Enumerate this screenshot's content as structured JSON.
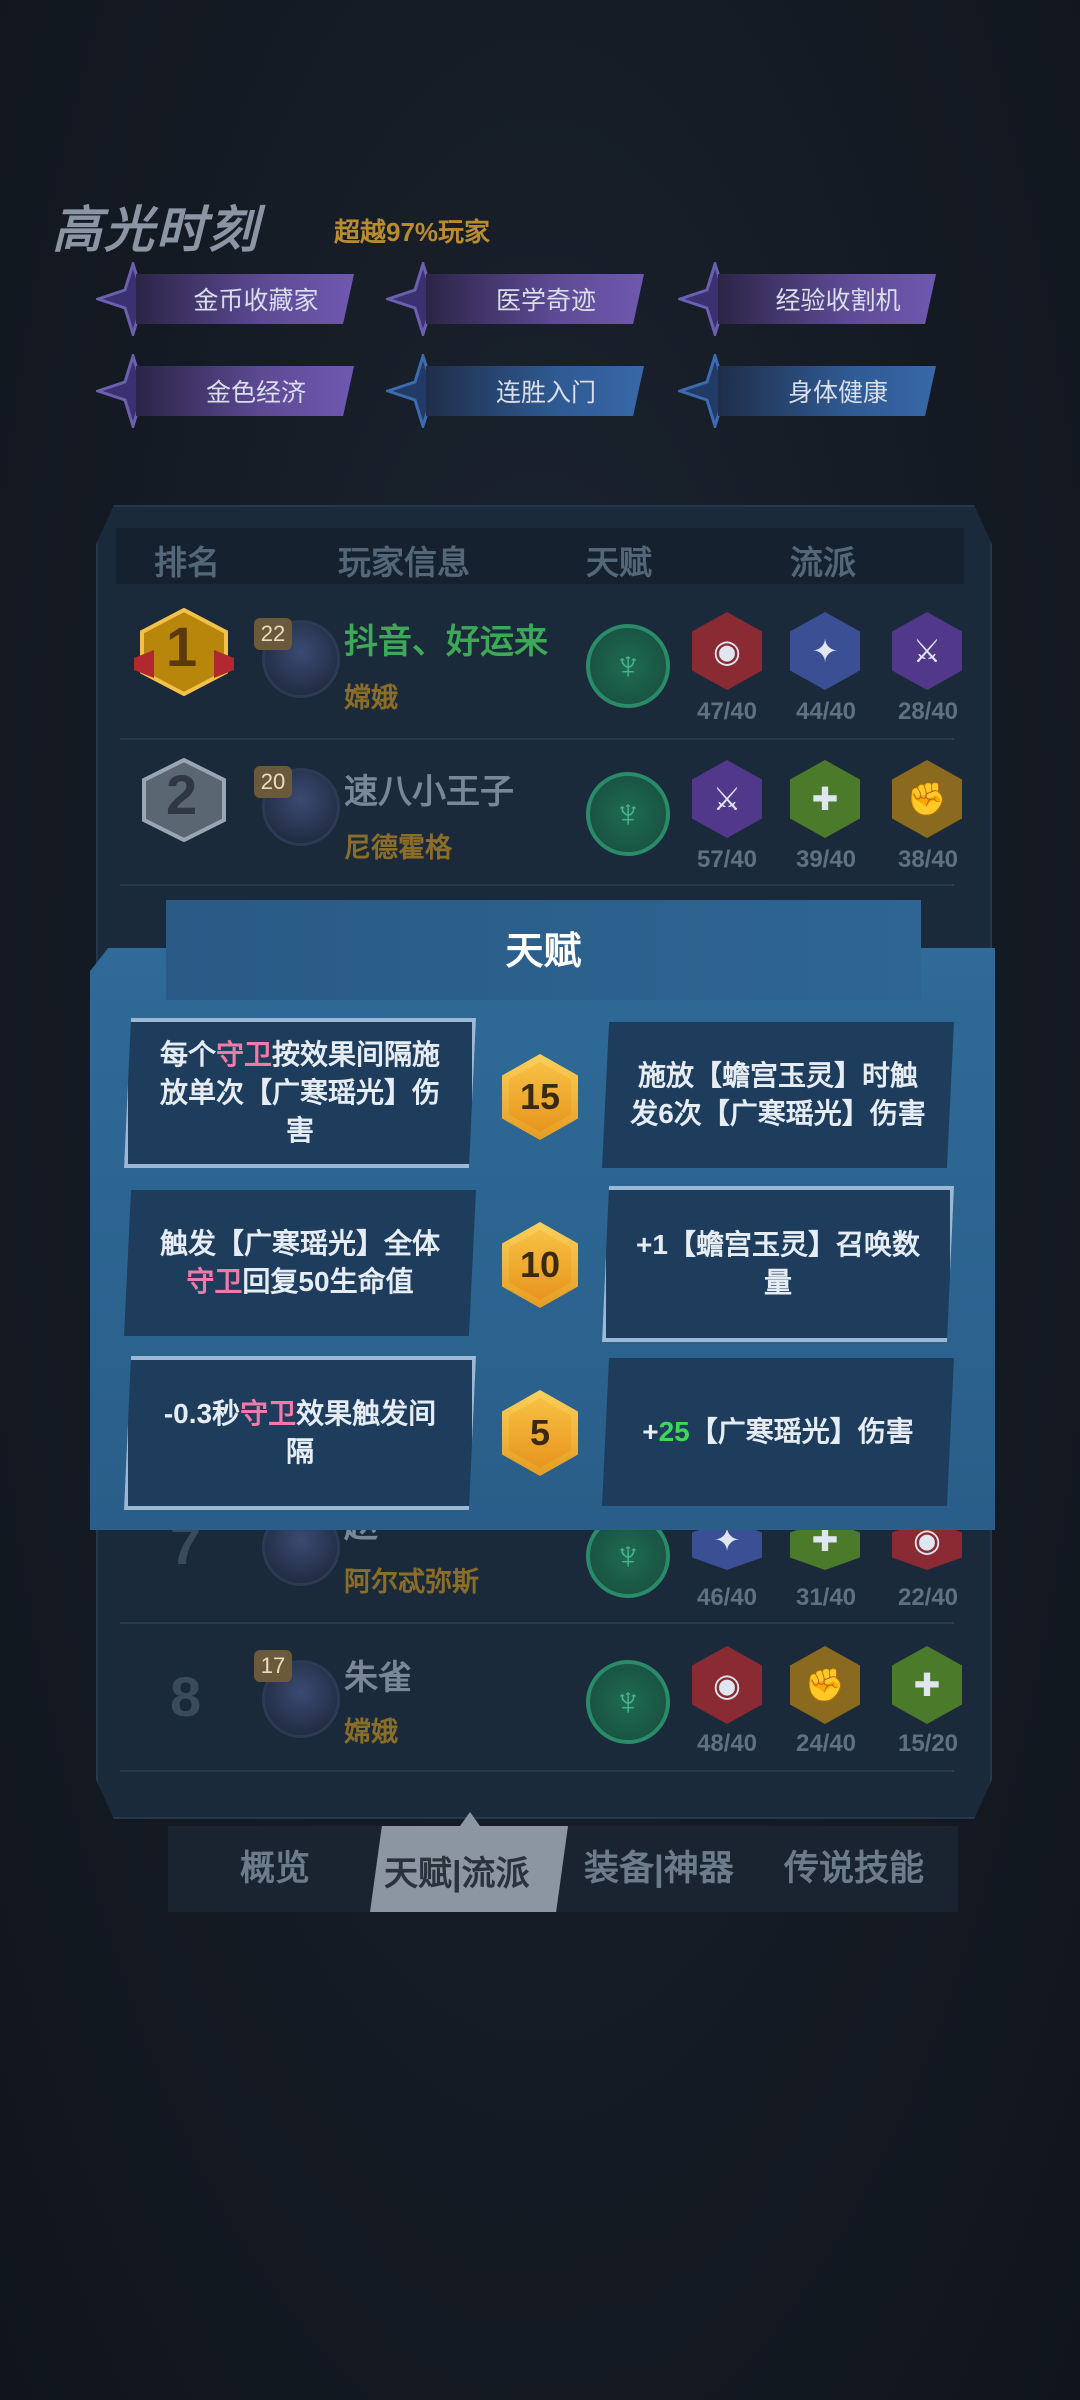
{
  "highlight": {
    "title": "高光时刻",
    "subtitle": "超越97%玩家",
    "badges": [
      {
        "label": "金币收藏家",
        "color": "purple"
      },
      {
        "label": "医学奇迹",
        "color": "purple"
      },
      {
        "label": "经验收割机",
        "color": "purple"
      },
      {
        "label": "金色经济",
        "color": "purple"
      },
      {
        "label": "连胜入门",
        "color": "blue"
      },
      {
        "label": "身体健康",
        "color": "blue"
      }
    ]
  },
  "ranking": {
    "headers": [
      "排名",
      "玩家信息",
      "天赋",
      "流派"
    ],
    "rows": [
      {
        "rank": "1",
        "level": "22",
        "name": "抖音、好运来",
        "hero": "嫦娥",
        "counts": [
          "47/40",
          "44/40",
          "28/40"
        ]
      },
      {
        "rank": "2",
        "level": "20",
        "name": "速八小王子",
        "hero": "尼德霍格",
        "counts": [
          "57/40",
          "39/40",
          "38/40"
        ]
      },
      {
        "rank": "7",
        "level": "",
        "name": "赵",
        "hero": "阿尔忒弥斯",
        "counts": [
          "46/40",
          "31/40",
          "22/40"
        ]
      },
      {
        "rank": "8",
        "level": "17",
        "name": "朱雀",
        "hero": "嫦娥",
        "counts": [
          "48/40",
          "24/40",
          "15/20"
        ]
      }
    ]
  },
  "talent_modal": {
    "title": "天赋",
    "tiers": [
      {
        "level": "15",
        "left": {
          "pre": "每个",
          "hl": "守卫",
          "post": "按效果间隔施放单次【广寒瑶光】伤害",
          "selected": true
        },
        "right": {
          "text": "施放【蟾宫玉灵】时触发6次【广寒瑶光】伤害",
          "selected": false
        }
      },
      {
        "level": "10",
        "left": {
          "pre": "触发【广寒瑶光】全体",
          "hl": "守卫",
          "post": "回复50生命值",
          "selected": false
        },
        "right": {
          "text": "+1【蟾宫玉灵】召唤数量",
          "selected": true
        }
      },
      {
        "level": "5",
        "left": {
          "pre": "-0.3秒",
          "hl": "守卫",
          "post": "效果触发间隔",
          "selected": true
        },
        "right": {
          "pre": "+",
          "num": "25",
          "post": "【广寒瑶光】伤害",
          "selected": false
        }
      }
    ]
  },
  "tabs": [
    {
      "label": "概览",
      "active": false
    },
    {
      "label": "天赋|流派",
      "active": true
    },
    {
      "label": "装备|神器",
      "active": false
    },
    {
      "label": "传说技能",
      "active": false
    }
  ]
}
